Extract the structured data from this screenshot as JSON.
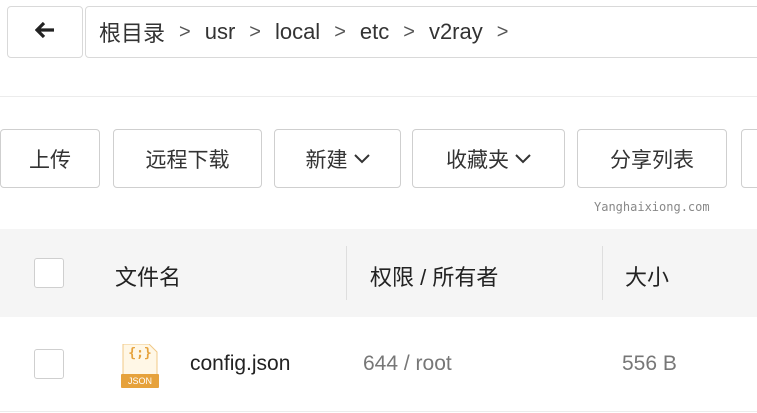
{
  "breadcrumb": {
    "items": [
      "根目录",
      "usr",
      "local",
      "etc",
      "v2ray"
    ],
    "separator": ">"
  },
  "toolbar": {
    "upload": "上传",
    "remote_download": "远程下载",
    "new": "新建",
    "favorites": "收藏夹",
    "share_list": "分享列表"
  },
  "watermark": "Yanghaixiong.com",
  "table": {
    "headers": {
      "name": "文件名",
      "permission_owner": "权限 / 所有者",
      "size": "大小"
    },
    "rows": [
      {
        "name": "config.json",
        "permission_owner": "644 / root",
        "size": "556 B",
        "icon_label": "JSON",
        "icon_glyph": "{;}"
      }
    ]
  },
  "colors": {
    "border": "#d9d9d9",
    "header_bg": "#f5f5f5",
    "json_icon": "#e6a23c"
  }
}
